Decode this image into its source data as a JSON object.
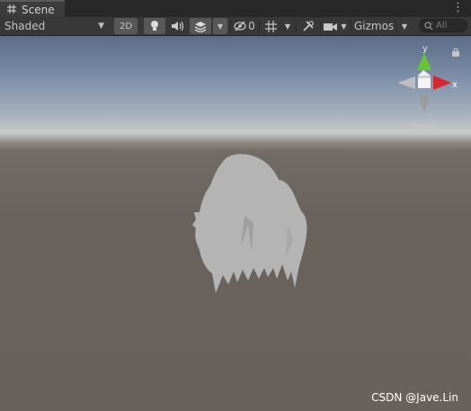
{
  "tab": {
    "title": "Scene",
    "icon": "grid-icon"
  },
  "toolbar": {
    "draw_mode": "Shaded",
    "mode_2d": "2D",
    "hidden_count": "0",
    "gizmos": "Gizmos",
    "search_placeholder": "All"
  },
  "scene_gizmo": {
    "y_label": "y",
    "x_label": "x",
    "projection": "Persp"
  },
  "watermark": "CSDN @Jave.Lin",
  "colors": {
    "axis_x": "#d8262a",
    "axis_y": "#62c92a",
    "axis_z": "#ffffff",
    "hair": "#b4b4b4",
    "ground": "#69615c"
  }
}
